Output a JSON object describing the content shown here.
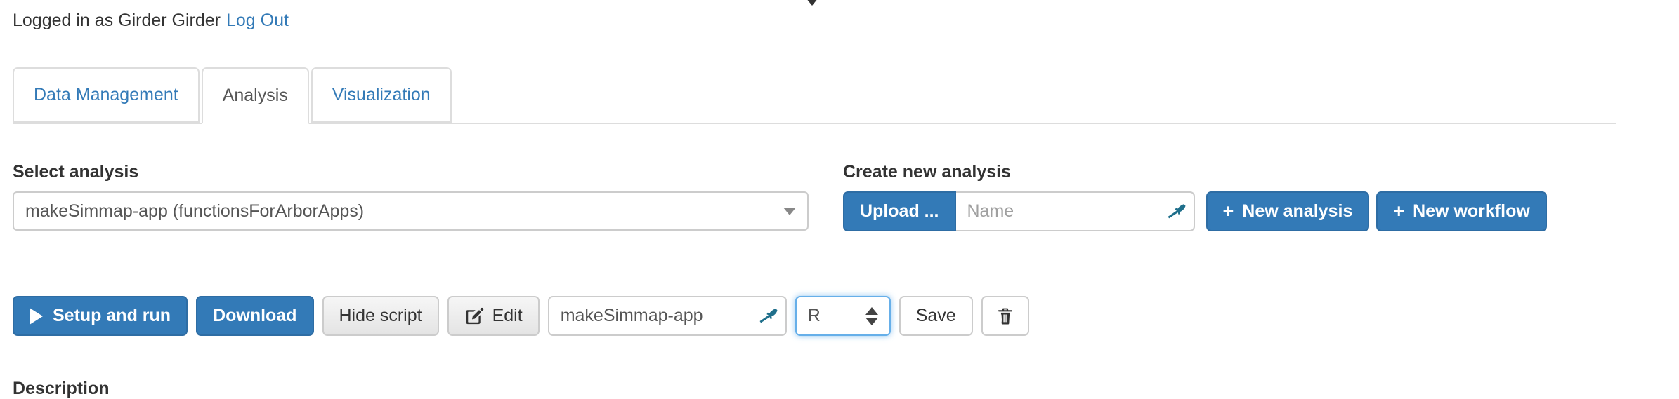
{
  "header": {
    "logged_in_text": "Logged in as Girder Girder",
    "logout_label": "Log Out"
  },
  "tabs": [
    {
      "label": "Data Management",
      "active": false
    },
    {
      "label": "Analysis",
      "active": true
    },
    {
      "label": "Visualization",
      "active": false
    }
  ],
  "select_analysis": {
    "label": "Select analysis",
    "value": "makeSimmap-app (functionsForArborApps)"
  },
  "create_new": {
    "label": "Create new analysis",
    "upload_label": "Upload ...",
    "name_value": "",
    "name_placeholder": "Name",
    "new_analysis_label": "New analysis",
    "new_workflow_label": "New workflow",
    "plus_glyph": "+"
  },
  "toolbar": {
    "setup_and_run_label": "Setup and run",
    "download_label": "Download",
    "hide_script_label": "Hide script",
    "edit_label": "Edit",
    "script_name_value": "makeSimmap-app",
    "language_value": "R",
    "save_label": "Save"
  },
  "description": {
    "label": "Description"
  },
  "colors": {
    "primary": "#337ab7",
    "primary_border": "#2e6da4",
    "link": "#337ab7",
    "text": "#333333",
    "muted_text": "#555555",
    "border": "#cccccc",
    "tab_border": "#dddddd",
    "focus_ring": "#66afe9",
    "wrench_icon": "#1f6f8b"
  }
}
